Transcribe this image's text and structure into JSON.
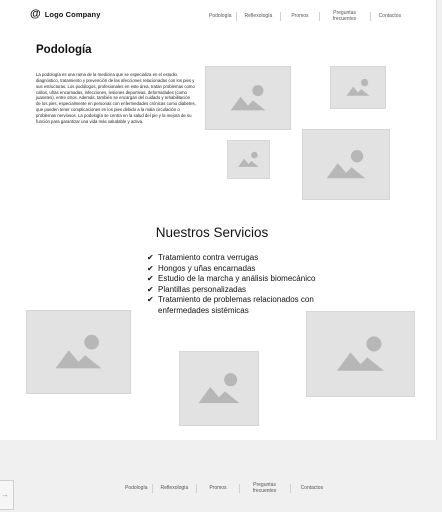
{
  "header": {
    "logo_icon": "@",
    "logo_text": "Logo Company",
    "nav": [
      "Podología",
      "Reflexología",
      "Promos",
      "Preguntas frecuentes",
      "Contactos"
    ]
  },
  "podologia": {
    "title": "Podología",
    "text": "La podología es una rama de la medicina que se especializa en el estudio, diagnóstico, tratamiento y prevención de las afecciones relacionadas con los pies y sus estructuras. Los podólogos, profesionales en este área, tratan problemas como callos, uñas encarnadas, infecciones, lesiones deportivas, deformidades (como juanetes), entre otros. Además, también se encargan del cuidado y rehabilitación de los pies, especialmente en personas con enfermedades crónicas como diabetes, que pueden tener complicaciones en los pies debido a la mala circulación o problemas nerviosos. La podología se centra en la salud del pie y la mejora de su función para garantizar una vida más saludable y activa."
  },
  "servicios": {
    "title": "Nuestros Servicios",
    "items": [
      "Tratamiento contra verrugas",
      "Hongos y uñas encarnadas",
      "Estudio de la marcha y análisis biomecánico",
      "Plantillas personalizadas",
      "Tratamiento de problemas relacionados con enfermedades sistémicas"
    ],
    "check_icon": "checkmark-icon"
  },
  "footer": {
    "nav": [
      "Podología",
      "Reflexología",
      "Promos",
      "Preguntas frecuentes",
      "Contactos"
    ]
  },
  "colors": {
    "placeholder_bg": "#e2e2e2",
    "placeholder_shape": "#b7b7b7",
    "page_bg": "#ffffff",
    "outer_bg": "#f0f0f0"
  }
}
